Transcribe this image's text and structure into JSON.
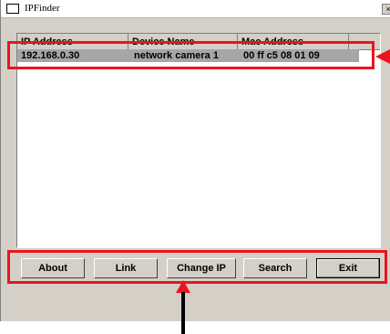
{
  "window": {
    "title": "IPFinder",
    "close_glyph": "×"
  },
  "columns": [
    "IP Address",
    "Device Name",
    "Mac Address"
  ],
  "rows": [
    {
      "ip": "192.168.0.30",
      "name": "network camera 1",
      "mac": "00 ff c5 08 01 09"
    }
  ],
  "buttons": {
    "about": "About",
    "link": "Link",
    "change_ip": "Change IP",
    "search": "Search",
    "exit": "Exit"
  },
  "colors": {
    "highlight": "#e8161c",
    "row_selected": "#a6a6a6",
    "face": "#d4d0c8"
  }
}
